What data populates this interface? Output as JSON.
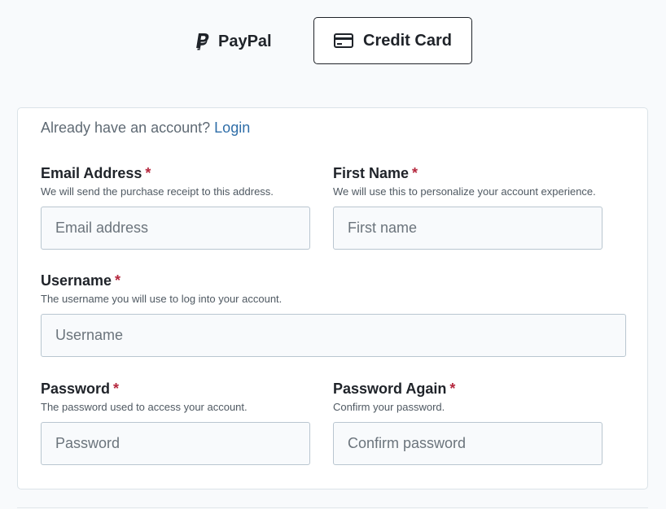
{
  "payment_tabs": {
    "paypal": {
      "label": "PayPal",
      "icon": "paypal-icon"
    },
    "credit_card": {
      "label": "Credit Card",
      "icon": "credit-card-icon",
      "selected": true
    }
  },
  "account": {
    "prompt": "Already have an account?",
    "login_link": "Login"
  },
  "fields": {
    "email": {
      "label": "Email Address",
      "required": "*",
      "help": "We will send the purchase receipt to this address.",
      "placeholder": "Email address",
      "value": ""
    },
    "first_name": {
      "label": "First Name",
      "required": "*",
      "help": "We will use this to personalize your account experience.",
      "placeholder": "First name",
      "value": ""
    },
    "username": {
      "label": "Username",
      "required": "*",
      "help": "The username you will use to log into your account.",
      "placeholder": "Username",
      "value": ""
    },
    "password": {
      "label": "Password",
      "required": "*",
      "help": "The password used to access your account.",
      "placeholder": "Password",
      "value": ""
    },
    "password_again": {
      "label": "Password Again",
      "required": "*",
      "help": "Confirm your password.",
      "placeholder": "Confirm password",
      "value": ""
    }
  },
  "colors": {
    "required_marker": "#b5283e",
    "link": "#2f6ea8",
    "input_border": "#b9c6d0",
    "input_background": "#f8fafc"
  }
}
